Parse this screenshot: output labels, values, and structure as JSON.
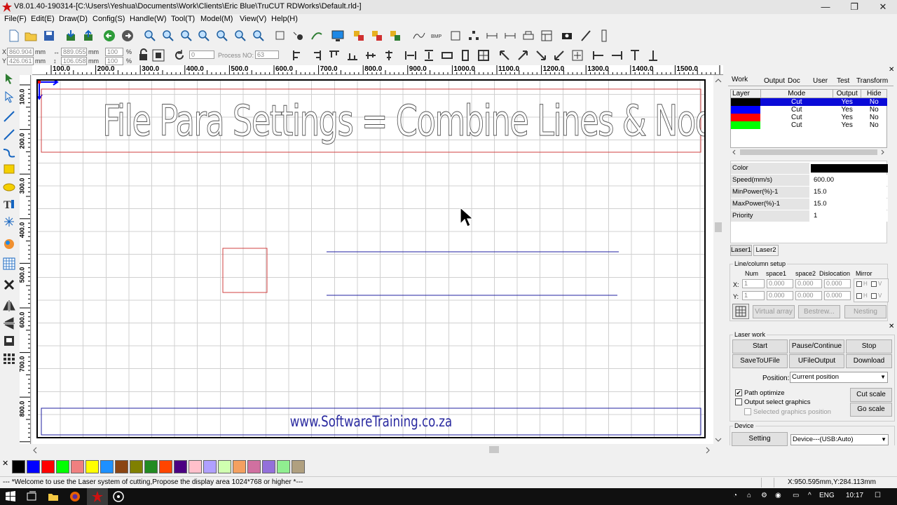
{
  "window": {
    "title": "V8.01.40-190314-[C:\\Users\\Yeshua\\Documents\\Work\\Clients\\Eric Blue\\TruCUT RDWorks\\Default.rld-]",
    "minimize": "—",
    "restore": "❐",
    "close": "✕"
  },
  "menu": {
    "items": [
      "File(F)",
      "Edit(E)",
      "Draw(D)",
      "Config(S)",
      "Handle(W)",
      "Tool(T)",
      "Model(M)",
      "View(V)",
      "Help(H)"
    ]
  },
  "coords": {
    "x_label": "X",
    "y_label": "Y",
    "x_value": "860.904",
    "y_value": "426.061",
    "w_value": "889.055",
    "h_value": "106.058",
    "unit_mm": "mm",
    "sx_value": "100",
    "sy_value": "100",
    "unit_pct": "%",
    "rotate_value": "0",
    "process_label": "Process NO:",
    "process_value": "63"
  },
  "ruler": {
    "h_labels": [
      "100.0",
      "200.0",
      "300.0",
      "400.0",
      "500.0",
      "600.0",
      "700.0",
      "800.0",
      "900.0",
      "1000.0",
      "1100.0",
      "1200.0",
      "1300.0",
      "1400.0",
      "1500.0"
    ],
    "v_labels": [
      "100.0",
      "200.0",
      "300.0",
      "400.0",
      "500.0",
      "600.0",
      "700.0",
      "800.0"
    ]
  },
  "canvas": {
    "headline": "File Para Settings = Combine Lines & Nodes",
    "footer_url": "www.SoftwareTraining.co.za"
  },
  "palette": {
    "colors": [
      "#000000",
      "#0000ff",
      "#ff0000",
      "#00ff00",
      "#f08080",
      "#ffff00",
      "#1e90ff",
      "#8b4513",
      "#808000",
      "#228b22",
      "#ff4500",
      "#4b0082",
      "#ffc0cb",
      "#b0a0ff",
      "#d0ffb0",
      "#f4a060",
      "#d070a0",
      "#9370db",
      "#90ee90",
      "#b0a080"
    ]
  },
  "status": {
    "message": "--- *Welcome to use the Laser system of cutting,Propose the display area 1024*768 or higher *---",
    "coords": "X:950.595mm,Y:284.113mm"
  },
  "taskbar": {
    "lang": "ENG",
    "time": "10:17"
  },
  "panel": {
    "tabs": [
      "Work",
      "Output",
      "Doc",
      "User",
      "Test",
      "Transform"
    ],
    "layer_headers": [
      "Layer",
      "Mode",
      "Output",
      "Hide"
    ],
    "layers": [
      {
        "color": "#000000",
        "mode": "Cut",
        "output": "Yes",
        "hide": "No"
      },
      {
        "color": "#0000ff",
        "mode": "Cut",
        "output": "Yes",
        "hide": "No"
      },
      {
        "color": "#ff0000",
        "mode": "Cut",
        "output": "Yes",
        "hide": "No"
      },
      {
        "color": "#00ff00",
        "mode": "Cut",
        "output": "Yes",
        "hide": "No"
      }
    ],
    "props": [
      {
        "label": "Color",
        "value": ""
      },
      {
        "label": "Speed(mm/s)",
        "value": "600.00"
      },
      {
        "label": "MinPower(%)-1",
        "value": "15.0"
      },
      {
        "label": "MaxPower(%)-1",
        "value": "15.0"
      },
      {
        "label": "Priority",
        "value": "1"
      }
    ],
    "laser_tabs": [
      "Laser1",
      "Laser2"
    ],
    "array": {
      "title": "Line/column setup",
      "headers": [
        "Num",
        "space1",
        "space2",
        "Dislocation",
        "Mirror"
      ],
      "x_label": "X:",
      "y_label": "Y:",
      "num": "1",
      "zero": "0.000",
      "h": "H",
      "v": "V",
      "virtual_array": "Virtual array",
      "bestrew": "Bestrew...",
      "nesting": "Nesting"
    }
  },
  "laserwork": {
    "title": "Laser work",
    "start": "Start",
    "pause": "Pause/Continue",
    "stop": "Stop",
    "savetoufile": "SaveToUFile",
    "ufileoutput": "UFileOutput",
    "download": "Download",
    "position_label": "Position:",
    "position_value": "Current position",
    "path_optimize": "Path optimize",
    "output_select": "Output select graphics",
    "selected_pos": "Selected graphics position",
    "cut_scale": "Cut scale",
    "go_scale": "Go scale",
    "device_title": "Device",
    "setting": "Setting",
    "device_value": "Device---(USB:Auto)"
  }
}
